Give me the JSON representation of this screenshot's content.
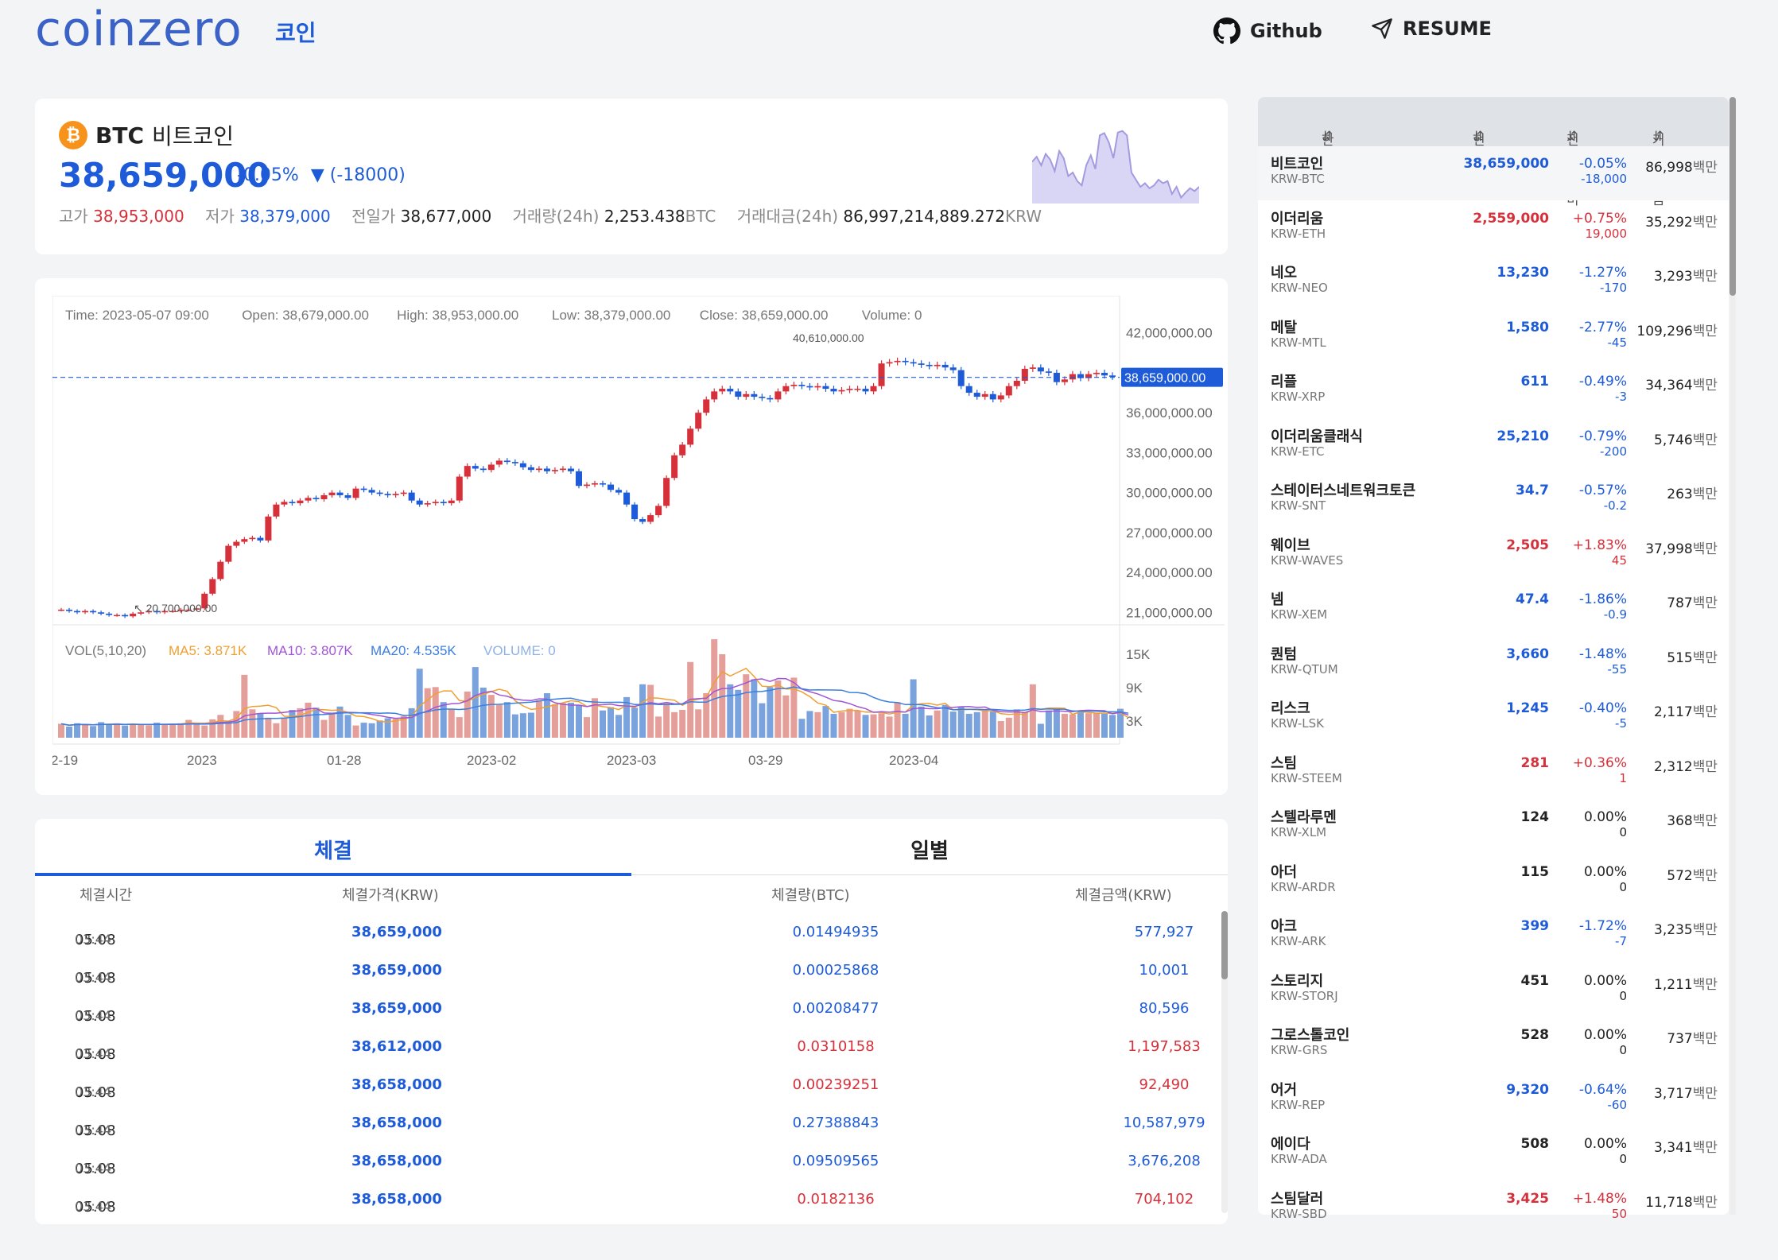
{
  "header": {
    "logo": "coinzero",
    "nav_coin": "코인",
    "github": "Github",
    "resume": "RESUME"
  },
  "ticker": {
    "symbol": "BTC",
    "name": "비트코인",
    "price": "38,659,000",
    "change_rate": "-0.05%",
    "change_arrow": "▼",
    "change_abs": "(-18000)",
    "high_label": "고가",
    "high": "38,953,000",
    "low_label": "저가",
    "low": "38,379,000",
    "prev_label": "전일가",
    "prev": "38,677,000",
    "vol_label": "거래량(24h)",
    "vol": "2,253.438",
    "vol_unit": "BTC",
    "amt_label": "거래대금(24h)",
    "amt": "86,997,214,889.272",
    "amt_unit": "KRW",
    "sparkline": [
      0.55,
      0.62,
      0.5,
      0.66,
      0.58,
      0.42,
      0.7,
      0.6,
      0.35,
      0.4,
      0.28,
      0.22,
      0.5,
      0.64,
      0.45,
      0.92,
      0.95,
      0.82,
      0.6,
      0.96,
      0.98,
      0.92,
      0.4,
      0.3,
      0.2,
      0.25,
      0.18,
      0.22,
      0.3,
      0.25,
      0.28,
      0.1,
      0.2,
      0.05,
      0.12,
      0.18,
      0.14,
      0.2
    ]
  },
  "chart_data": {
    "type": "candlestick",
    "info": {
      "time": "Time: 2023-05-07 09:00",
      "open": "Open: 38,679,000.00",
      "high": "High: 38,953,000.00",
      "low": "Low: 38,379,000.00",
      "close": "Close: 38,659,000.00",
      "volume": "Volume: 0"
    },
    "price_axis": [
      "42,000,000.00",
      "36,000,000.00",
      "33,000,000.00",
      "30,000,000.00",
      "27,000,000.00",
      "24,000,000.00",
      "21,000,000.00"
    ],
    "price_ticks": [
      42000000,
      36000000,
      33000000,
      30000000,
      27000000,
      24000000,
      21000000
    ],
    "current_price_label": "38,659,000.00",
    "current_price": 38659000,
    "max_label": "40,610,000.00",
    "min_label": "20,700,000.00",
    "x_labels": [
      "2-19",
      "2023",
      "01-28",
      "2023-02",
      "2023-03",
      "03-29",
      "2023-04"
    ],
    "closes": [
      21.2,
      21.1,
      21.0,
      21.1,
      21.0,
      20.9,
      20.8,
      20.8,
      20.7,
      20.9,
      21.0,
      21.1,
      21.0,
      21.1,
      21.1,
      21.2,
      21.2,
      21.3,
      22.4,
      23.5,
      24.8,
      26.0,
      26.3,
      26.5,
      26.6,
      26.4,
      28.2,
      29.1,
      29.3,
      29.2,
      29.4,
      29.6,
      29.5,
      29.8,
      30.0,
      29.8,
      29.6,
      30.3,
      30.2,
      30.0,
      29.9,
      29.8,
      29.9,
      30.0,
      29.4,
      29.1,
      29.2,
      29.3,
      29.2,
      29.4,
      31.2,
      32.0,
      31.8,
      31.7,
      32.1,
      32.4,
      32.3,
      32.2,
      31.9,
      31.7,
      31.8,
      31.6,
      31.7,
      31.8,
      31.6,
      30.5,
      30.6,
      30.7,
      30.6,
      30.2,
      30.0,
      29.1,
      28.0,
      27.8,
      28.3,
      29.0,
      31.1,
      32.8,
      33.6,
      34.8,
      36.0,
      37.0,
      37.6,
      37.8,
      37.6,
      37.2,
      37.4,
      37.2,
      37.1,
      37.0,
      37.6,
      38.0,
      38.1,
      38.0,
      37.9,
      38.0,
      37.8,
      37.6,
      37.7,
      37.8,
      37.8,
      37.6,
      38.0,
      39.7,
      39.8,
      39.9,
      39.8,
      39.7,
      39.6,
      39.5,
      39.6,
      39.4,
      39.2,
      38.0,
      37.5,
      37.2,
      37.4,
      37.0,
      37.3,
      38.0,
      38.4,
      39.3,
      39.4,
      39.1,
      39.0,
      38.3,
      38.5,
      38.9,
      38.6,
      38.9,
      39.0,
      38.8,
      38.7
    ],
    "ylim": [
      20000000,
      43000000
    ],
    "volume_panel": {
      "title": "VOL(5,10,20)",
      "ma5": "MA5: 3.871K",
      "ma10": "MA10: 3.807K",
      "ma20": "MA20: 4.535K",
      "volume": "VOLUME: 0",
      "axis": [
        "15K",
        "9K",
        "3K"
      ],
      "axis_values": [
        15000,
        9000,
        3000
      ],
      "max": 18000,
      "values": [
        2.5,
        2.0,
        2.6,
        2.4,
        2.1,
        2.8,
        2.3,
        2.6,
        2.2,
        2.5,
        2.3,
        2.2,
        2.7,
        2.4,
        2.4,
        2.6,
        3.2,
        2.5,
        2.2,
        3.3,
        4.1,
        2.8,
        4.8,
        11.3,
        5.1,
        4.4,
        3.6,
        2.6,
        3.6,
        5.0,
        5.3,
        6.3,
        5.4,
        3.2,
        4.4,
        5.6,
        4.1,
        2.2,
        2.7,
        2.6,
        3.1,
        3.5,
        3.4,
        3.9,
        5.3,
        12.4,
        8.9,
        9.1,
        6.4,
        5.2,
        3.7,
        8.3,
        12.7,
        9.0,
        7.7,
        5.9,
        6.4,
        4.2,
        4.4,
        4.5,
        6.7,
        8.0,
        6.0,
        6.2,
        6.3,
        5.9,
        3.7,
        7.1,
        4.9,
        5.5,
        4.1,
        7.3,
        5.4,
        9.6,
        9.5,
        3.8,
        6.2,
        4.6,
        5.0,
        13.6,
        5.1,
        8.0,
        17.7,
        15.0,
        9.6,
        8.6,
        11.4,
        10.5,
        6.2,
        9.1,
        10.3,
        7.6,
        10.8,
        3.4,
        4.8,
        4.6,
        5.7,
        4.3,
        4.6,
        5.2,
        4.8,
        4.1,
        4.2,
        4.4,
        3.8,
        6.4,
        4.3,
        10.5,
        5.6,
        4.0,
        4.9,
        5.9,
        4.7,
        5.6,
        4.3,
        4.6,
        5.0,
        4.7,
        3.0,
        3.6,
        5.1,
        4.6,
        9.6,
        2.5,
        4.9,
        5.1,
        4.3,
        4.2,
        4.8,
        4.4,
        4.4,
        4.3,
        4.1,
        5.2,
        0.0
      ]
    }
  },
  "tabs": {
    "trade": "체결",
    "daily": "일별"
  },
  "trades": {
    "headers": [
      "체결시간",
      "체결가격(KRW)",
      "체결량(BTC)",
      "체결금액(KRW)"
    ],
    "rows": [
      {
        "date": "05.08",
        "time": "03:44",
        "price": "38,659,000",
        "qty": "0.01494935",
        "amt": "577,927",
        "side": "down"
      },
      {
        "date": "05.08",
        "time": "03:44",
        "price": "38,659,000",
        "qty": "0.00025868",
        "amt": "10,001",
        "side": "down"
      },
      {
        "date": "05.08",
        "time": "03:44",
        "price": "38,659,000",
        "qty": "0.00208477",
        "amt": "80,596",
        "side": "down"
      },
      {
        "date": "05.08",
        "time": "03:44",
        "price": "38,612,000",
        "qty": "0.0310158",
        "amt": "1,197,583",
        "side": "up"
      },
      {
        "date": "05.08",
        "time": "03:44",
        "price": "38,658,000",
        "qty": "0.00239251",
        "amt": "92,490",
        "side": "up"
      },
      {
        "date": "05.08",
        "time": "03:44",
        "price": "38,658,000",
        "qty": "0.27388843",
        "amt": "10,587,979",
        "side": "down"
      },
      {
        "date": "05.08",
        "time": "03:44",
        "price": "38,658,000",
        "qty": "0.09509565",
        "amt": "3,676,208",
        "side": "down"
      },
      {
        "date": "05.08",
        "time": "03:44",
        "price": "38,658,000",
        "qty": "0.0182136",
        "amt": "704,102",
        "side": "up"
      }
    ]
  },
  "coin_list": {
    "headers": [
      "한글명",
      "현재가",
      "전일대비",
      "거래대금"
    ],
    "rows": [
      {
        "name": "비트코인",
        "code": "KRW-BTC",
        "price": "38,659,000",
        "rate": "-0.05%",
        "abs": "-18,000",
        "vol": "86,998",
        "unit": "백만",
        "dir": "down"
      },
      {
        "name": "이더리움",
        "code": "KRW-ETH",
        "price": "2,559,000",
        "rate": "+0.75%",
        "abs": "19,000",
        "vol": "35,292",
        "unit": "백만",
        "dir": "up"
      },
      {
        "name": "네오",
        "code": "KRW-NEO",
        "price": "13,230",
        "rate": "-1.27%",
        "abs": "-170",
        "vol": "3,293",
        "unit": "백만",
        "dir": "down"
      },
      {
        "name": "메탈",
        "code": "KRW-MTL",
        "price": "1,580",
        "rate": "-2.77%",
        "abs": "-45",
        "vol": "109,296",
        "unit": "백만",
        "dir": "down"
      },
      {
        "name": "리플",
        "code": "KRW-XRP",
        "price": "611",
        "rate": "-0.49%",
        "abs": "-3",
        "vol": "34,364",
        "unit": "백만",
        "dir": "down"
      },
      {
        "name": "이더리움클래식",
        "code": "KRW-ETC",
        "price": "25,210",
        "rate": "-0.79%",
        "abs": "-200",
        "vol": "5,746",
        "unit": "백만",
        "dir": "down"
      },
      {
        "name": "스테이터스네트워크토큰",
        "code": "KRW-SNT",
        "price": "34.7",
        "rate": "-0.57%",
        "abs": "-0.2",
        "vol": "263",
        "unit": "백만",
        "dir": "down"
      },
      {
        "name": "웨이브",
        "code": "KRW-WAVES",
        "price": "2,505",
        "rate": "+1.83%",
        "abs": "45",
        "vol": "37,998",
        "unit": "백만",
        "dir": "up"
      },
      {
        "name": "넴",
        "code": "KRW-XEM",
        "price": "47.4",
        "rate": "-1.86%",
        "abs": "-0.9",
        "vol": "787",
        "unit": "백만",
        "dir": "down"
      },
      {
        "name": "퀀텀",
        "code": "KRW-QTUM",
        "price": "3,660",
        "rate": "-1.48%",
        "abs": "-55",
        "vol": "515",
        "unit": "백만",
        "dir": "down"
      },
      {
        "name": "리스크",
        "code": "KRW-LSK",
        "price": "1,245",
        "rate": "-0.40%",
        "abs": "-5",
        "vol": "2,117",
        "unit": "백만",
        "dir": "down"
      },
      {
        "name": "스팀",
        "code": "KRW-STEEM",
        "price": "281",
        "rate": "+0.36%",
        "abs": "1",
        "vol": "2,312",
        "unit": "백만",
        "dir": "up"
      },
      {
        "name": "스텔라루멘",
        "code": "KRW-XLM",
        "price": "124",
        "rate": "0.00%",
        "abs": "0",
        "vol": "368",
        "unit": "백만",
        "dir": "flat"
      },
      {
        "name": "아더",
        "code": "KRW-ARDR",
        "price": "115",
        "rate": "0.00%",
        "abs": "0",
        "vol": "572",
        "unit": "백만",
        "dir": "flat"
      },
      {
        "name": "아크",
        "code": "KRW-ARK",
        "price": "399",
        "rate": "-1.72%",
        "abs": "-7",
        "vol": "3,235",
        "unit": "백만",
        "dir": "down"
      },
      {
        "name": "스토리지",
        "code": "KRW-STORJ",
        "price": "451",
        "rate": "0.00%",
        "abs": "0",
        "vol": "1,211",
        "unit": "백만",
        "dir": "flat"
      },
      {
        "name": "그로스톨코인",
        "code": "KRW-GRS",
        "price": "528",
        "rate": "0.00%",
        "abs": "0",
        "vol": "737",
        "unit": "백만",
        "dir": "flat"
      },
      {
        "name": "어거",
        "code": "KRW-REP",
        "price": "9,320",
        "rate": "-0.64%",
        "abs": "-60",
        "vol": "3,717",
        "unit": "백만",
        "dir": "down"
      },
      {
        "name": "에이다",
        "code": "KRW-ADA",
        "price": "508",
        "rate": "0.00%",
        "abs": "0",
        "vol": "3,341",
        "unit": "백만",
        "dir": "flat"
      },
      {
        "name": "스팀달러",
        "code": "KRW-SBD",
        "price": "3,425",
        "rate": "+1.48%",
        "abs": "50",
        "vol": "11,718",
        "unit": "백만",
        "dir": "up"
      }
    ]
  },
  "colors": {
    "brand": "#3b63c7",
    "up": "#d6303a",
    "down": "#1e5bd8",
    "btc": "#f7931a"
  }
}
